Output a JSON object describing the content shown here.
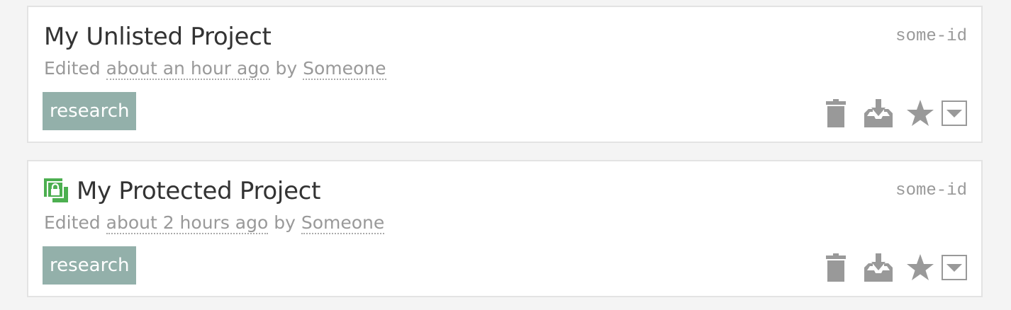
{
  "projects": [
    {
      "title": "My Unlisted Project",
      "id": "some-id",
      "edited_prefix": "Edited ",
      "edited_time": "about an hour ago",
      "by_word": " by ",
      "author": "Someone",
      "tag": "research",
      "protected": false
    },
    {
      "title": "My Protected Project",
      "id": "some-id",
      "edited_prefix": "Edited ",
      "edited_time": "about 2 hours ago",
      "by_word": " by ",
      "author": "Someone",
      "tag": "research",
      "protected": true
    }
  ],
  "icons": {
    "trash": "trash-icon",
    "download": "download-icon",
    "star": "star-icon",
    "dropdown": "caret-down-icon",
    "lock": "protected-lock-icon"
  },
  "colors": {
    "tag_bg": "#93b0aa",
    "icon_gray": "#999999",
    "lock_green": "#4caf50",
    "title": "#333333",
    "muted": "#999999"
  }
}
